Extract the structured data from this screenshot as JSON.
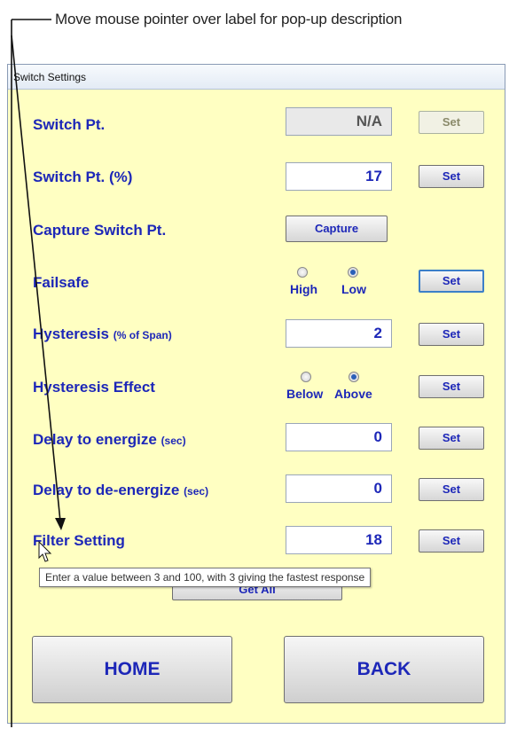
{
  "callout": "Move mouse pointer over label for pop-up description",
  "window": {
    "title": "Switch Settings"
  },
  "rows": {
    "switch_pt": {
      "label": "Switch Pt.",
      "value": "N/A",
      "button": "Set"
    },
    "switch_pt_pct": {
      "label": "Switch Pt.  (%)",
      "value": "17",
      "button": "Set"
    },
    "capture": {
      "label": "Capture Switch Pt.",
      "button": "Capture"
    },
    "failsafe": {
      "label": "Failsafe",
      "option_high": "High",
      "option_low": "Low",
      "selected": "Low",
      "button": "Set"
    },
    "hysteresis": {
      "label": "Hysteresis",
      "unit": "(% of Span)",
      "value": "2",
      "button": "Set"
    },
    "hysteresis_effect": {
      "label": "Hysteresis Effect",
      "option_below": "Below",
      "option_above": "Above",
      "selected": "Above",
      "button": "Set"
    },
    "delay_energize": {
      "label": "Delay to energize",
      "unit": "(sec)",
      "value": "0",
      "button": "Set"
    },
    "delay_deenergize": {
      "label": "Delay to de-energize",
      "unit": "(sec)",
      "value": "0",
      "button": "Set"
    },
    "filter": {
      "label": "Filter Setting",
      "value": "18",
      "button": "Set"
    }
  },
  "tooltip": "Enter a value between 3 and 100, with 3 giving the fastest response",
  "get_all": "Get All",
  "home": "HOME",
  "back": "BACK"
}
